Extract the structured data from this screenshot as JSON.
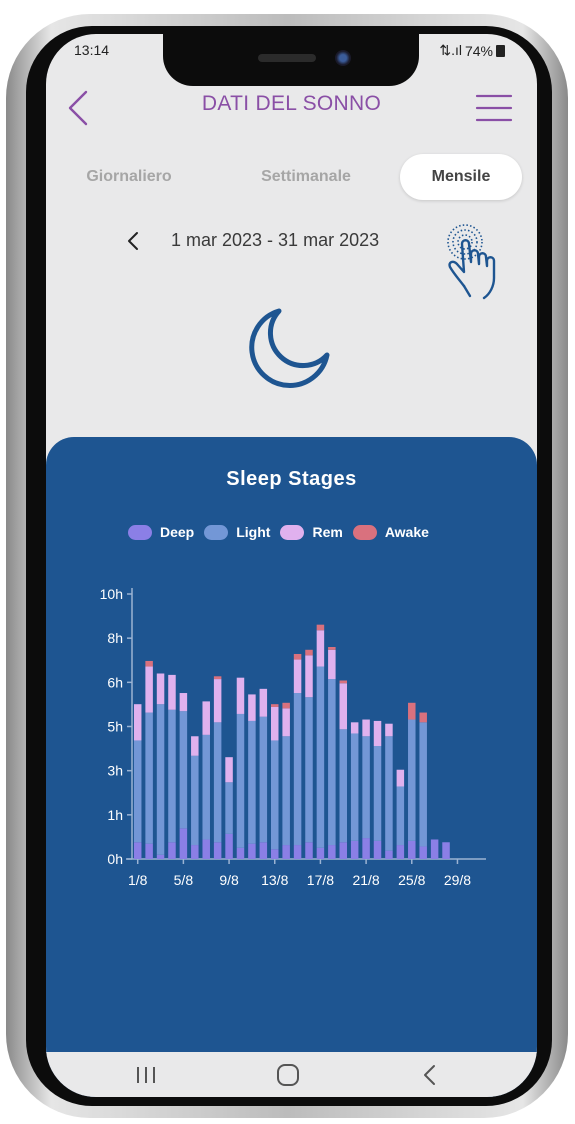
{
  "status_bar": {
    "time": "13:14",
    "signal": "⇅.ıl",
    "battery": "74%"
  },
  "header": {
    "title": "DATI DEL SONNO"
  },
  "tabs": [
    {
      "label": "Giornaliero"
    },
    {
      "label": "Settimanale"
    },
    {
      "label": "Mensile",
      "selected": true
    }
  ],
  "date_range": "1 mar 2023 - 31 mar 2023",
  "colors": {
    "deep": "#8b7fe6",
    "light": "#7397d6",
    "rem": "#e0b1ee",
    "awake": "#d9717e",
    "card": "#1e5591",
    "title_purple": "#8a4fa6"
  },
  "chart_data": {
    "type": "bar",
    "stacked": true,
    "title": "Sleep Stages",
    "legend_position": "top",
    "series": [
      {
        "name": "Deep",
        "values": [
          1.2,
          1.1,
          0.3,
          1.2,
          2.2,
          1.0,
          1.4,
          1.2,
          1.8,
          0.8,
          1.1,
          1.2,
          0.7,
          1.0,
          1.0,
          1.2,
          0.8,
          1.0,
          1.2,
          1.3,
          1.5,
          1.3,
          0.6,
          1.0,
          1.3,
          0.9,
          1.4,
          1.2
        ]
      },
      {
        "name": "Light",
        "values": [
          7.3,
          9.4,
          10.8,
          9.5,
          8.4,
          6.4,
          7.5,
          8.6,
          3.7,
          9.6,
          8.8,
          9.0,
          7.8,
          7.8,
          10.9,
          10.4,
          13.0,
          11.9,
          8.1,
          7.7,
          7.3,
          6.8,
          8.2,
          4.2,
          8.7,
          8.9,
          0,
          0
        ]
      },
      {
        "name": "Rem",
        "values": [
          2.6,
          3.3,
          2.2,
          2.5,
          1.3,
          1.4,
          2.4,
          3.1,
          1.8,
          2.6,
          1.9,
          2.0,
          2.4,
          2.0,
          2.4,
          3.0,
          2.6,
          2.1,
          3.3,
          0.8,
          1.2,
          1.8,
          0.9,
          1.2,
          0,
          0,
          0,
          0
        ]
      },
      {
        "name": "Awake",
        "values": [
          0,
          0.4,
          0,
          0,
          0,
          0,
          0,
          0.2,
          0,
          0,
          0,
          0,
          0.2,
          0.4,
          0.4,
          0.4,
          0.4,
          0.2,
          0.2,
          0,
          0,
          0,
          0,
          0,
          1.2,
          0.7,
          0,
          0
        ]
      }
    ],
    "x": [
      "1/8",
      "2/8",
      "3/8",
      "4/8",
      "5/8",
      "6/8",
      "7/8",
      "8/8",
      "9/8",
      "10/8",
      "11/8",
      "12/8",
      "13/8",
      "14/8",
      "15/8",
      "16/8",
      "17/8",
      "18/8",
      "19/8",
      "20/8",
      "21/8",
      "22/8",
      "23/8",
      "24/8",
      "25/8",
      "26/8",
      "27/8",
      "28/8",
      "29/8",
      "30/8",
      "31/8"
    ],
    "xtick_labels": [
      "1/8",
      "5/8",
      "9/8",
      "13/8",
      "17/8",
      "21/8",
      "25/8",
      "29/8"
    ],
    "ytick_labels": [
      "0h",
      "1h",
      "3h",
      "5h",
      "6h",
      "8h",
      "10h"
    ],
    "ylim": [
      0,
      19
    ]
  },
  "nav": {
    "recent": "recent-apps",
    "home": "home",
    "back": "back"
  }
}
